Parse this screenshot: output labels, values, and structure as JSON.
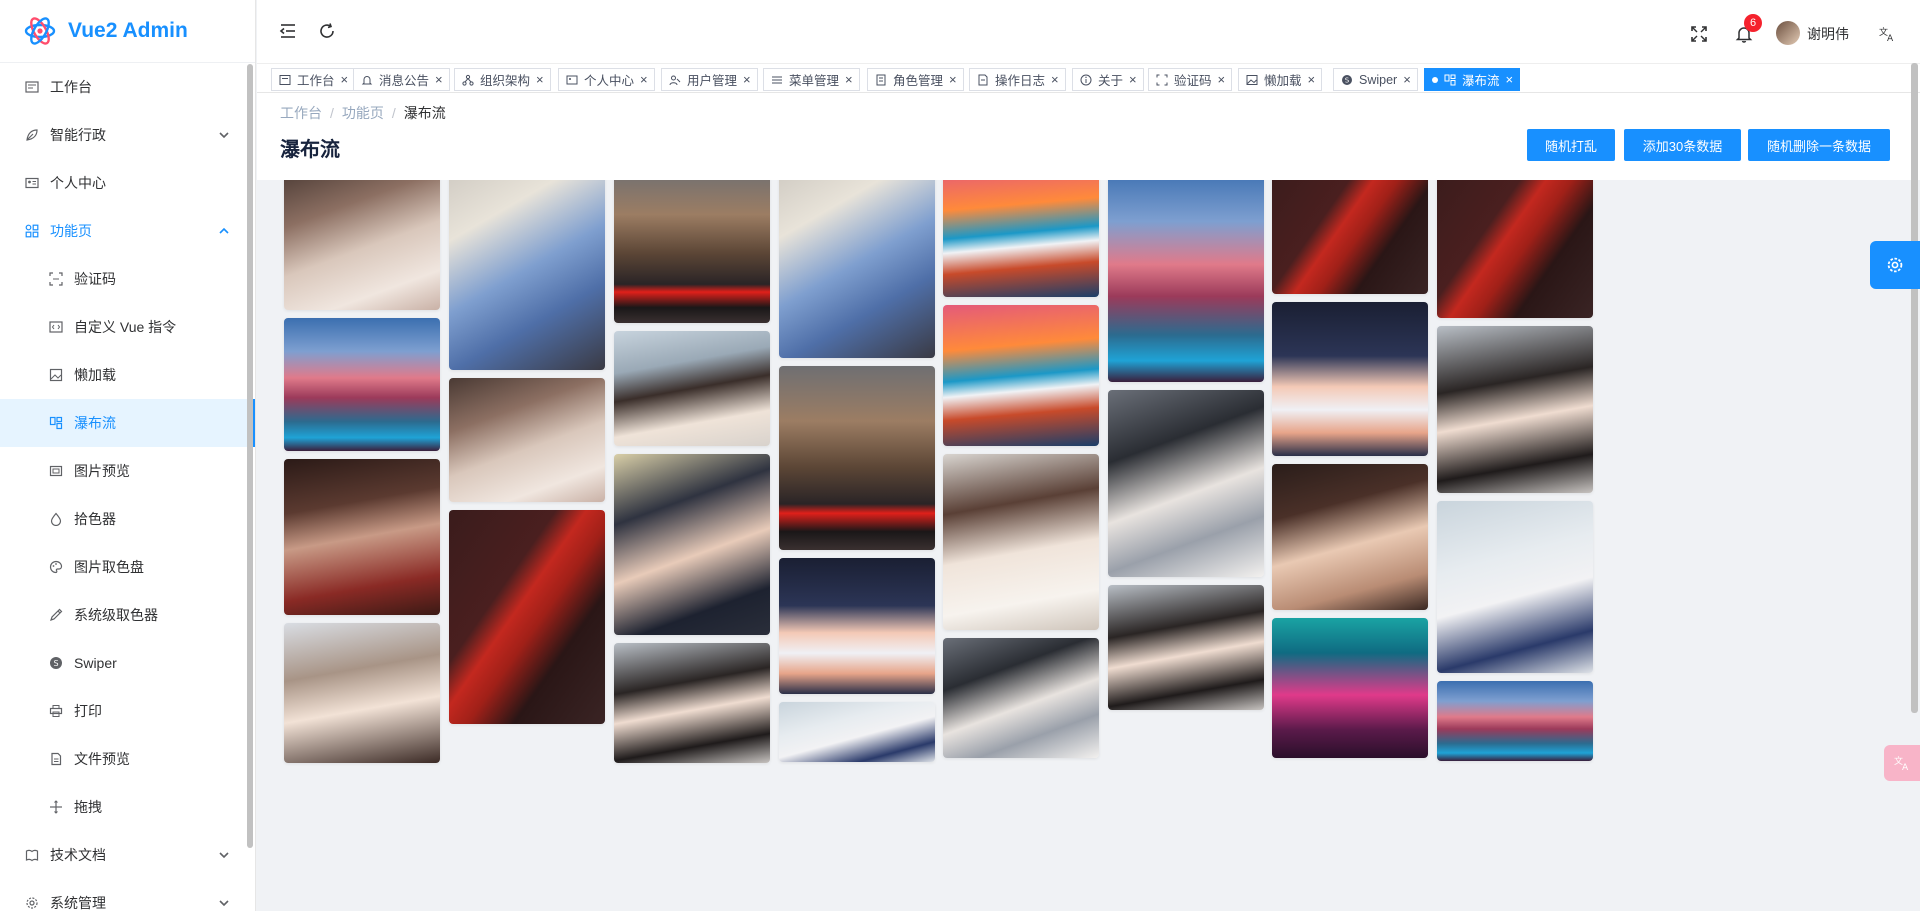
{
  "app": {
    "title": "Vue2 Admin",
    "brand_color": "#1890ff",
    "logo_icon": "react-atom-logo"
  },
  "sidebar": {
    "items": [
      {
        "label": "工作台",
        "icon": "dashboard-icon"
      },
      {
        "label": "智能行政",
        "icon": "leaf-icon",
        "expandable": true
      },
      {
        "label": "个人中心",
        "icon": "id-card-icon"
      },
      {
        "label": "功能页",
        "icon": "apps-icon",
        "expanded": true
      },
      {
        "label": "验证码",
        "icon": "scan-icon"
      },
      {
        "label": "自定义 Vue 指令",
        "icon": "code-icon"
      },
      {
        "label": "懒加载",
        "icon": "image-icon"
      },
      {
        "label": "瀑布流",
        "icon": "waterfall-icon",
        "active": true
      },
      {
        "label": "图片预览",
        "icon": "picture-icon"
      },
      {
        "label": "拾色器",
        "icon": "drop-icon"
      },
      {
        "label": "图片取色盘",
        "icon": "palette-icon"
      },
      {
        "label": "系统级取色器",
        "icon": "eyedropper-icon"
      },
      {
        "label": "Swiper",
        "icon": "swiper-icon"
      },
      {
        "label": "打印",
        "icon": "printer-icon"
      },
      {
        "label": "文件预览",
        "icon": "file-icon"
      },
      {
        "label": "拖拽",
        "icon": "move-icon"
      },
      {
        "label": "技术文档",
        "icon": "book-icon",
        "expandable": true
      },
      {
        "label": "系统管理",
        "icon": "gear-icon",
        "expandable": true
      }
    ]
  },
  "header": {
    "notification_count": "6",
    "username": "谢明伟"
  },
  "tabs": [
    {
      "label": "工作台",
      "icon": "dashboard-icon"
    },
    {
      "label": "消息公告",
      "icon": "bell-icon"
    },
    {
      "label": "组织架构",
      "icon": "org-icon"
    },
    {
      "label": "个人中心",
      "icon": "id-card-icon"
    },
    {
      "label": "用户管理",
      "icon": "users-icon"
    },
    {
      "label": "菜单管理",
      "icon": "menu-icon"
    },
    {
      "label": "角色管理",
      "icon": "role-icon"
    },
    {
      "label": "操作日志",
      "icon": "log-icon"
    },
    {
      "label": "关于",
      "icon": "info-icon"
    },
    {
      "label": "验证码",
      "icon": "scan-icon"
    },
    {
      "label": "懒加载",
      "icon": "image-icon"
    },
    {
      "label": "Swiper",
      "icon": "swiper-icon"
    },
    {
      "label": "瀑布流",
      "icon": "waterfall-icon",
      "active": true
    }
  ],
  "breadcrumb": [
    "工作台",
    "功能页",
    "瀑布流"
  ],
  "page": {
    "title": "瀑布流",
    "buttons": [
      "随机打乱",
      "添加30条数据",
      "随机删除一条数据"
    ]
  },
  "gallery": {
    "columns": [
      [
        "portrait-girl-white-dress",
        "castle-sunset-landscape",
        "portrait-girl-red-scarf",
        "portrait-girl-long-hair"
      ],
      [
        "anime-blue-hair-girl",
        "portrait-girl-white-dress",
        "red-stripe-abstract"
      ],
      [
        "sports-car-cliff",
        "portrait-girl-seaside",
        "portrait-girl-dark-hair",
        "anime-dark-hair-girl"
      ],
      [
        "anime-blue-hair-girl",
        "sports-car-cliff",
        "chibi-girl-with-cat",
        "anime-silver-hair-girl"
      ],
      [
        "volcano-clouds",
        "volcano-clouds",
        "portrait-girl-reading",
        "keyboard-lap"
      ],
      [
        "castle-sunset-landscape",
        "keyboard-lap",
        "anime-dark-hair-girl"
      ],
      [
        "red-stripe-abstract",
        "chibi-girl-with-cat",
        "portrait-girl-glasses",
        "neon-city-arc"
      ],
      [
        "red-stripe-abstract",
        "anime-dark-hair-girl",
        "anime-silver-hair-girl",
        "castle-sunset-landscape"
      ]
    ]
  }
}
